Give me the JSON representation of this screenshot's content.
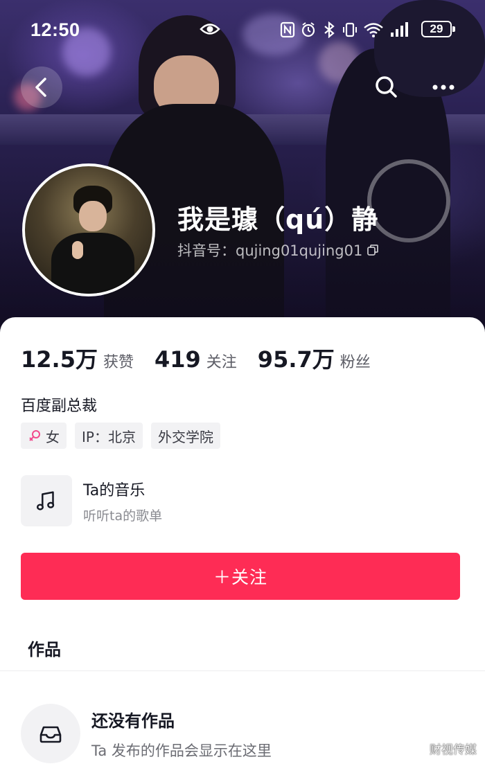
{
  "status_bar": {
    "time": "12:50",
    "battery": "29",
    "icons": [
      "eye-icon",
      "nfc-icon",
      "alarm-icon",
      "bluetooth-icon",
      "vibrate-icon",
      "wifi-icon",
      "signal-icon"
    ]
  },
  "nav": {
    "back_icon": "chevron-left-icon",
    "search_icon": "search-icon",
    "more_icon": "more-horizontal-icon"
  },
  "profile": {
    "name": "我是璩（qú）静",
    "douyin_id": "抖音号：qujing01qujing01"
  },
  "stats": [
    {
      "value": "12.5万",
      "label": "获赞"
    },
    {
      "value": "419",
      "label": "关注"
    },
    {
      "value": "95.7万",
      "label": "粉丝"
    }
  ],
  "bio": "百度副总裁",
  "tags": [
    {
      "icon": "female-icon",
      "label": "女",
      "icon_color": "#f14a8c"
    },
    {
      "label": "IP：北京"
    },
    {
      "label": "外交学院"
    }
  ],
  "music": {
    "title": "Ta的音乐",
    "subtitle": "听听ta的歌单"
  },
  "follow_button": {
    "label": "＋关注",
    "color": "#fe2c55"
  },
  "works": {
    "tab_label": "作品",
    "empty_title": "还没有作品",
    "empty_subtitle": "Ta 发布的作品会显示在这里"
  },
  "watermark": "财视传媒"
}
